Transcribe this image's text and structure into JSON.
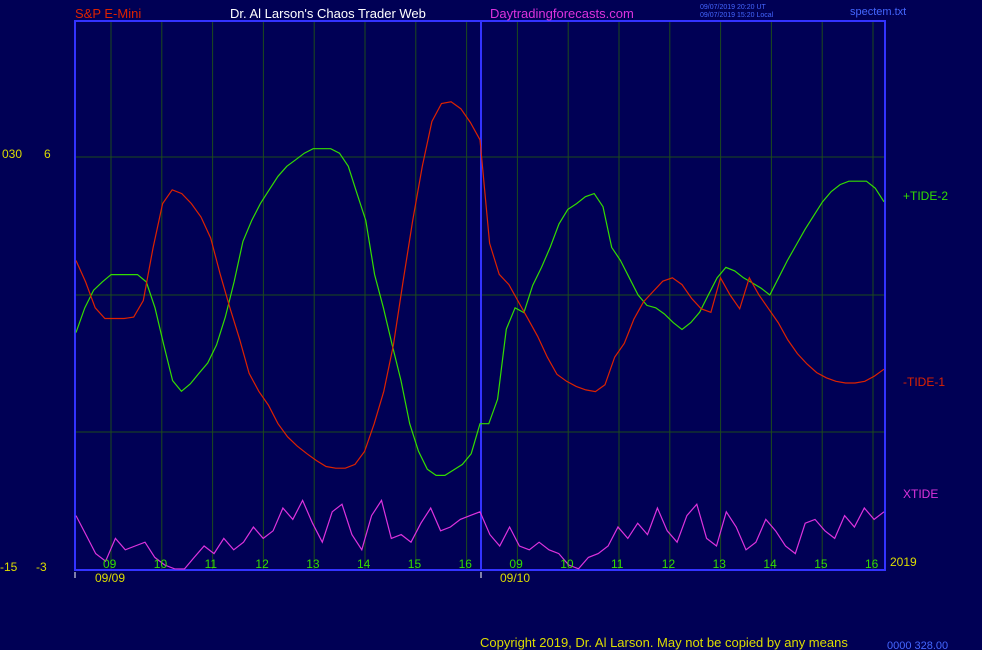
{
  "header": {
    "symbol": "S&P E-Mini",
    "author": "Dr. Al Larson's Chaos Trader Web",
    "site": "Daytradingforecasts.com",
    "time_ut": "09/07/2019 20:20 UT",
    "time_local": "09/07/2019 15:20 Local",
    "file": "spectem.txt"
  },
  "footer": {
    "copyright": "Copyright 2019, Dr. Al Larson. May not be copied by any means",
    "corner": "0000 328.00"
  },
  "colors": {
    "background": "#000055",
    "frame": "#3333ff",
    "grid": "#1c4a1c",
    "tide2": "#33dd00",
    "tide1": "#dd2200",
    "xtide": "#dd33dd",
    "label": "#dddd00"
  },
  "chart_data": {
    "type": "line",
    "title": "",
    "xlabel": "",
    "ylabel": "",
    "ylim": [
      -15,
      6
    ],
    "y_ticks_left": [
      "030",
      "6"
    ],
    "y_ticks_bottom": [
      "-15",
      "-3"
    ],
    "year": "2019",
    "hour_ticks": [
      "09",
      "10",
      "11",
      "12",
      "13",
      "14",
      "15",
      "16",
      "09",
      "10",
      "11",
      "12",
      "13",
      "14",
      "15",
      "16"
    ],
    "date_labels": [
      "09/09",
      "09/10"
    ],
    "x": [
      0,
      8,
      16,
      24,
      32,
      40,
      48,
      56,
      64,
      72,
      80,
      88,
      96,
      104,
      112,
      120,
      128,
      136,
      144,
      152,
      160,
      168,
      176,
      184,
      192,
      200,
      208,
      216,
      224,
      232,
      240,
      248,
      256,
      264,
      272,
      280,
      288,
      296,
      304,
      312,
      320,
      328,
      336,
      344,
      352,
      360,
      368,
      376,
      384,
      392,
      400,
      408,
      416,
      424,
      432,
      440,
      448,
      456,
      464,
      472,
      480,
      488,
      496,
      504,
      512,
      520,
      528,
      536,
      544,
      552,
      560,
      568,
      576,
      584,
      592,
      600,
      608,
      616,
      624,
      632,
      640,
      648,
      656,
      664,
      672,
      680,
      688,
      696,
      704,
      712,
      720,
      728,
      736,
      744,
      752,
      760,
      768,
      776,
      784,
      792,
      800,
      808
    ],
    "series": [
      {
        "name": "+TIDE-2",
        "values": [
          0.91,
          1.63,
          2.14,
          2.38,
          2.59,
          2.59,
          2.59,
          2.59,
          2.38,
          1.63,
          0.55,
          -0.48,
          -0.79,
          -0.58,
          -0.27,
          0.03,
          0.55,
          1.36,
          2.38,
          3.55,
          4.16,
          4.65,
          5.05,
          5.44,
          5.73,
          5.92,
          6.11,
          6.24,
          6.24,
          6.24,
          6.11,
          5.73,
          4.94,
          4.16,
          2.59,
          1.63,
          0.55,
          -0.48,
          -1.73,
          -2.53,
          -3.05,
          -3.23,
          -3.23,
          -3.07,
          -2.91,
          -2.6,
          -1.73,
          -1.73,
          -1.02,
          1.01,
          1.63,
          1.49,
          2.28,
          2.8,
          3.39,
          4.06,
          4.48,
          4.65,
          4.85,
          4.94,
          4.56,
          3.38,
          3.0,
          2.5,
          2.0,
          1.7,
          1.63,
          1.45,
          1.2,
          1.0,
          1.2,
          1.5,
          2.0,
          2.5,
          2.8,
          2.7,
          2.5,
          2.35,
          2.2,
          2.0,
          2.5,
          3.0,
          3.45,
          3.9,
          4.3,
          4.7,
          5.0,
          5.2,
          5.3,
          5.3,
          5.3,
          5.1,
          4.7
        ]
      },
      {
        "name": "-TIDE-1",
        "values": [
          3.0,
          2.38,
          1.63,
          1.32,
          1.32,
          1.32,
          1.36,
          1.84,
          3.36,
          4.65,
          5.05,
          4.94,
          4.65,
          4.26,
          3.65,
          2.59,
          1.63,
          0.73,
          -0.27,
          -0.79,
          -1.19,
          -1.73,
          -2.11,
          -2.38,
          -2.6,
          -2.8,
          -2.97,
          -3.02,
          -3.02,
          -2.91,
          -2.53,
          -1.73,
          -0.79,
          0.55,
          2.38,
          4.16,
          5.73,
          7.03,
          7.55,
          7.6,
          7.4,
          7.0,
          6.5,
          3.5,
          2.6,
          2.3,
          1.8,
          1.3,
          0.8,
          0.2,
          -0.3,
          -0.5,
          -0.65,
          -0.75,
          -0.8,
          -0.6,
          0.2,
          0.6,
          1.3,
          1.8,
          2.1,
          2.4,
          2.5,
          2.3,
          1.9,
          1.6,
          1.5,
          2.5,
          2.0,
          1.6,
          2.5,
          2.0,
          1.6,
          1.2,
          0.7,
          0.3,
          0.0,
          -0.25,
          -0.4,
          -0.5,
          -0.55,
          -0.55,
          -0.5,
          -0.35,
          -0.15
        ]
      },
      {
        "name": "XTIDE",
        "values": [
          -2.2,
          -2.7,
          -3.2,
          -3.4,
          -2.8,
          -3.1,
          -3.0,
          -2.9,
          -3.3,
          -3.5,
          -3.6,
          -3.7,
          -3.3,
          -3.0,
          -3.2,
          -2.8,
          -3.1,
          -2.9,
          -2.5,
          -2.8,
          -2.6,
          -2.0,
          -2.3,
          -1.8,
          -2.4,
          -2.9,
          -2.1,
          -1.9,
          -2.7,
          -3.1,
          -2.2,
          -1.8,
          -2.8,
          -2.7,
          -2.9,
          -2.4,
          -2.0,
          -2.6,
          -2.5,
          -2.3,
          -2.2,
          -2.1,
          -2.7,
          -3.0,
          -2.5,
          -3.0,
          -3.1,
          -2.9,
          -3.1,
          -3.2,
          -3.5,
          -3.6,
          -3.3,
          -3.2,
          -3.0,
          -2.5,
          -2.8,
          -2.4,
          -2.7,
          -2.0,
          -2.6,
          -2.9,
          -2.2,
          -1.9,
          -2.8,
          -3.0,
          -2.1,
          -2.5,
          -3.1,
          -2.9,
          -2.3,
          -2.6,
          -3.0,
          -3.2,
          -2.4,
          -2.3,
          -2.6,
          -2.8,
          -2.2,
          -2.5,
          -2.0,
          -2.3,
          -2.1
        ]
      }
    ]
  }
}
